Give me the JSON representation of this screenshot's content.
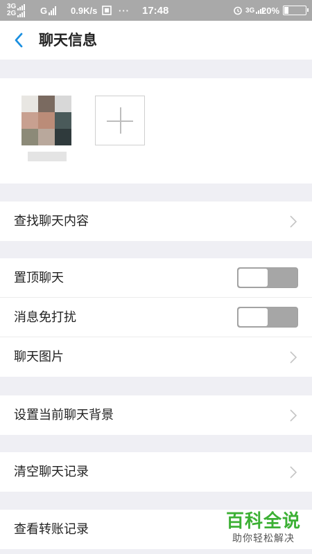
{
  "status_bar": {
    "net_top": "3G",
    "net_bottom": "2G",
    "net_type": "G",
    "speed": "0.9K/s",
    "more": "···",
    "time": "17:48",
    "net_right": "3G",
    "battery": "20%",
    "battery_level": 0.2
  },
  "nav": {
    "title": "聊天信息"
  },
  "rows": {
    "search_history": "查找聊天内容",
    "pin_chat": "置顶聊天",
    "mute": "消息免打扰",
    "chat_images": "聊天图片",
    "set_background": "设置当前聊天背景",
    "clear_history": "清空聊天记录",
    "transfer_records": "查看转账记录"
  },
  "toggles": {
    "pin_chat": false,
    "mute": false
  },
  "watermark": {
    "title": "百科全说",
    "subtitle": "助你轻松解决"
  },
  "colors": {
    "accent": "#1a8fe0",
    "watermark_green": "#3cb034",
    "toggle_off": "#a6a6a6",
    "status_bar": "#a9a9a9"
  }
}
